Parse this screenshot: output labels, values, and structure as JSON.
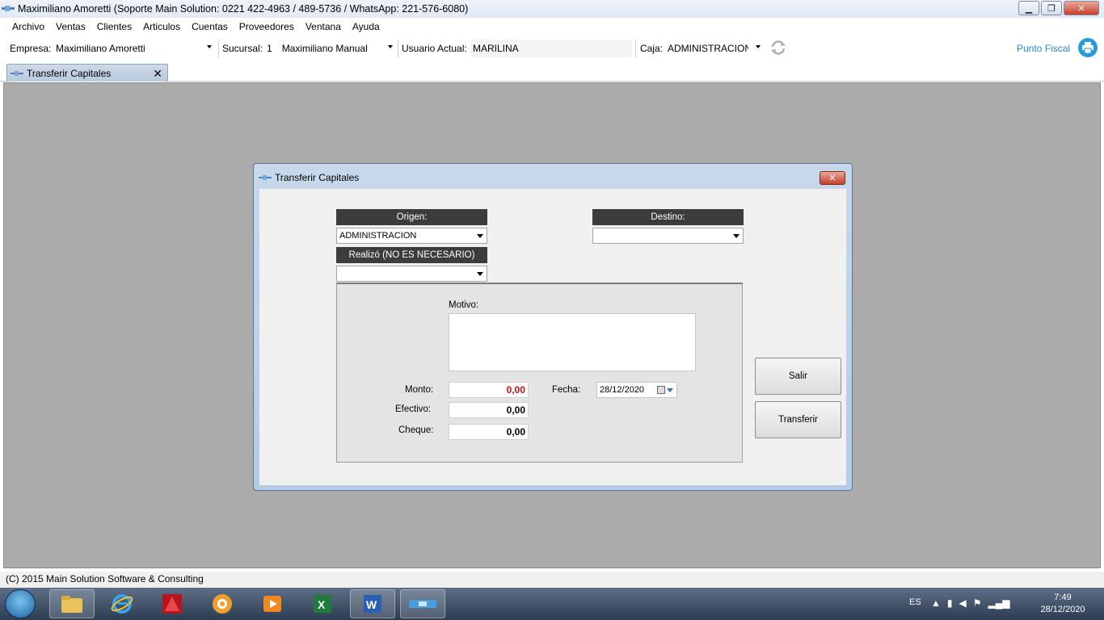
{
  "window": {
    "title": "Maximiliano Amoretti (Soporte Main Solution: 0221 422-4963 / 489-5736 / WhatsApp: 221-576-6080)"
  },
  "menu": [
    "Archivo",
    "Ventas",
    "Clientes",
    "Articulos",
    "Cuentas",
    "Proveedores",
    "Ventana",
    "Ayuda"
  ],
  "toolbar": {
    "empresa_label": "Empresa:",
    "empresa_value": "Maximiliano Amoretti",
    "sucursal_label": "Sucursal:",
    "sucursal_num": "1",
    "sucursal_value": "Maximiliano Manual",
    "usuario_label": "Usuario Actual:",
    "usuario_value": "MARILINA",
    "caja_label": "Caja:",
    "caja_value": "ADMINISTRACION",
    "punto_fiscal": "Punto Fiscal"
  },
  "tab": {
    "label": "Transferir Capitales",
    "close": "✕"
  },
  "dialog": {
    "title": "Transferir Capitales",
    "close": "✕",
    "origen_header": "Origen:",
    "origen_value": "ADMINISTRACION",
    "destino_header": "Destino:",
    "destino_value": "",
    "realizo_header": "Realizó (NO ES NECESARIO)",
    "realizo_value": "",
    "motivo_label": "Motivo:",
    "motivo_value": "",
    "monto_label": "Monto:",
    "monto_value": "0,00",
    "efectivo_label": "Efectivo:",
    "efectivo_value": "0,00",
    "cheque_label": "Cheque:",
    "cheque_value": "0,00",
    "fecha_label": "Fecha:",
    "fecha_value": "28/12/2020",
    "salir_button": "Salir",
    "transferir_button": "Transferir"
  },
  "status": {
    "copyright": "(C) 2015 Main Solution Software & Consulting"
  },
  "taskbar": {
    "language": "ES",
    "time": "7:49",
    "date": "28/12/2020"
  },
  "colors": {
    "dialog_frame": "#b5cbe4",
    "header_dark": "#3c3c3c",
    "monto_red": "#c01010",
    "punto_fiscal_blue": "#2b88c8"
  }
}
